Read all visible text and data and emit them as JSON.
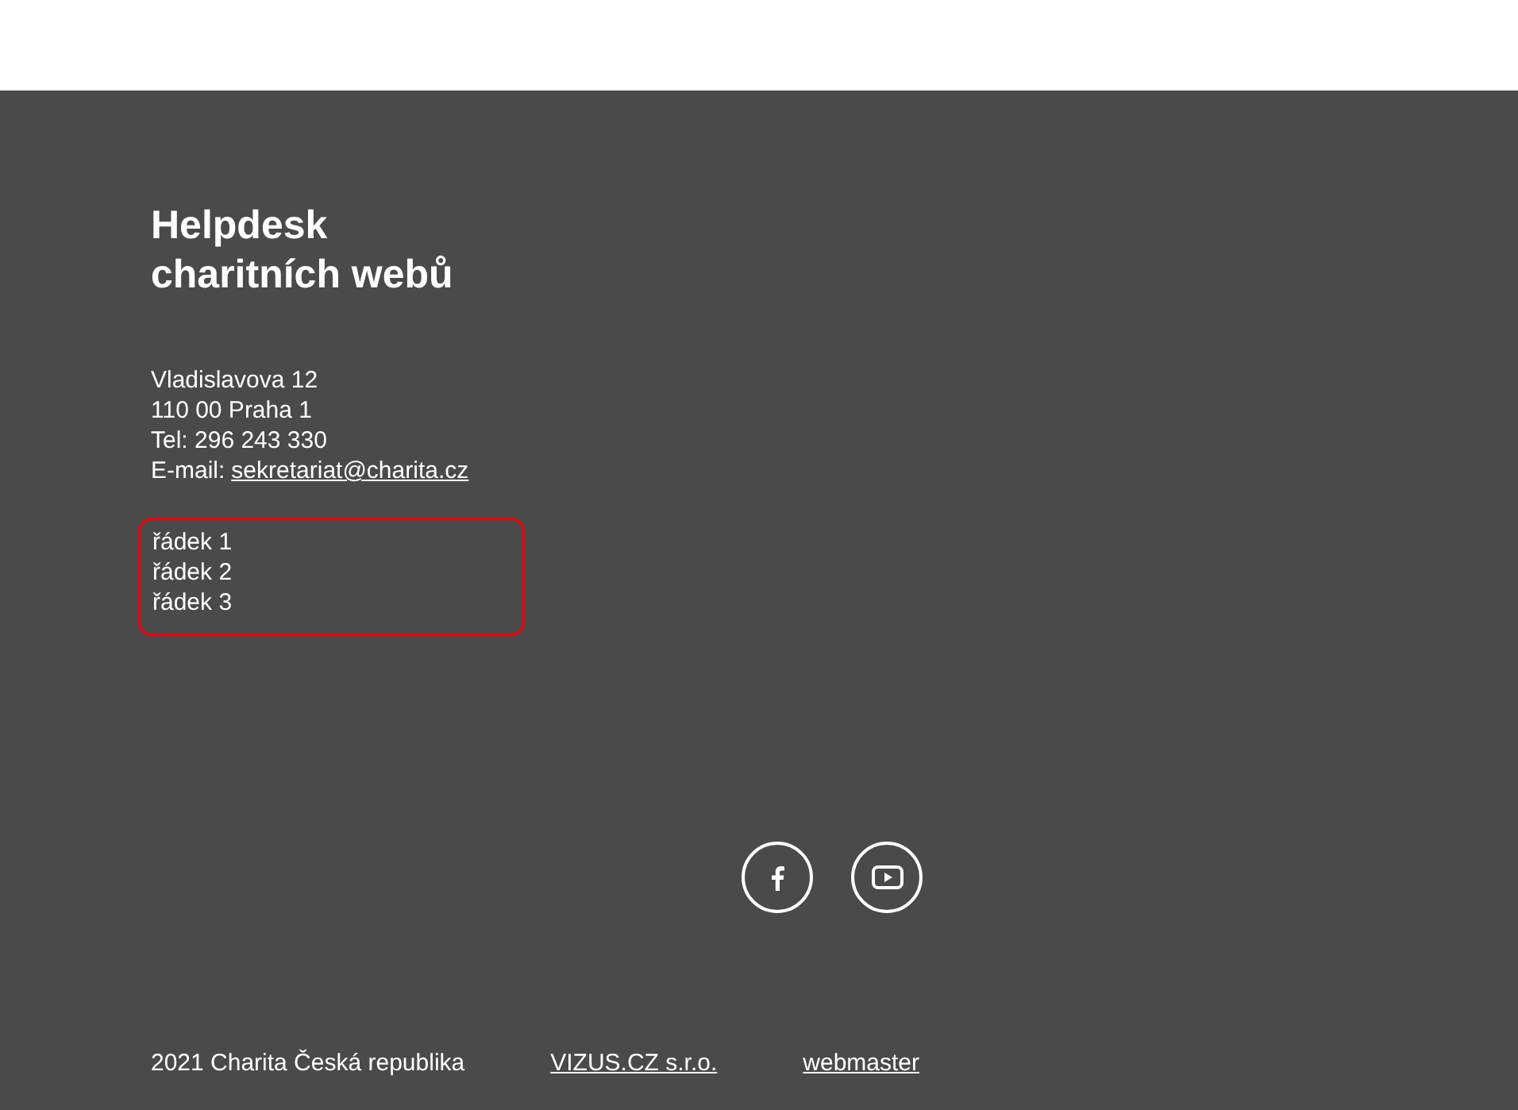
{
  "footer": {
    "title_lines": [
      "Helpdesk",
      "charitních webů"
    ],
    "address": [
      {
        "kind": "text",
        "text": "Vladislavova 12"
      },
      {
        "kind": "text",
        "text": "110 00 Praha 1"
      },
      {
        "kind": "text",
        "text": "Tel: 296 243 330"
      },
      {
        "kind": "email",
        "label": "E-mail:",
        "link": "sekretariat@charita.cz"
      }
    ],
    "highlighted_lines": [
      "řádek 1",
      "řádek 2",
      "řádek 3"
    ],
    "social": [
      {
        "kind": "facebook"
      },
      {
        "kind": "youtube"
      }
    ],
    "copyright": "2021 Charita Česká republika",
    "links": [
      "VIZUS.CZ s.r.o.",
      "webmaster"
    ]
  }
}
